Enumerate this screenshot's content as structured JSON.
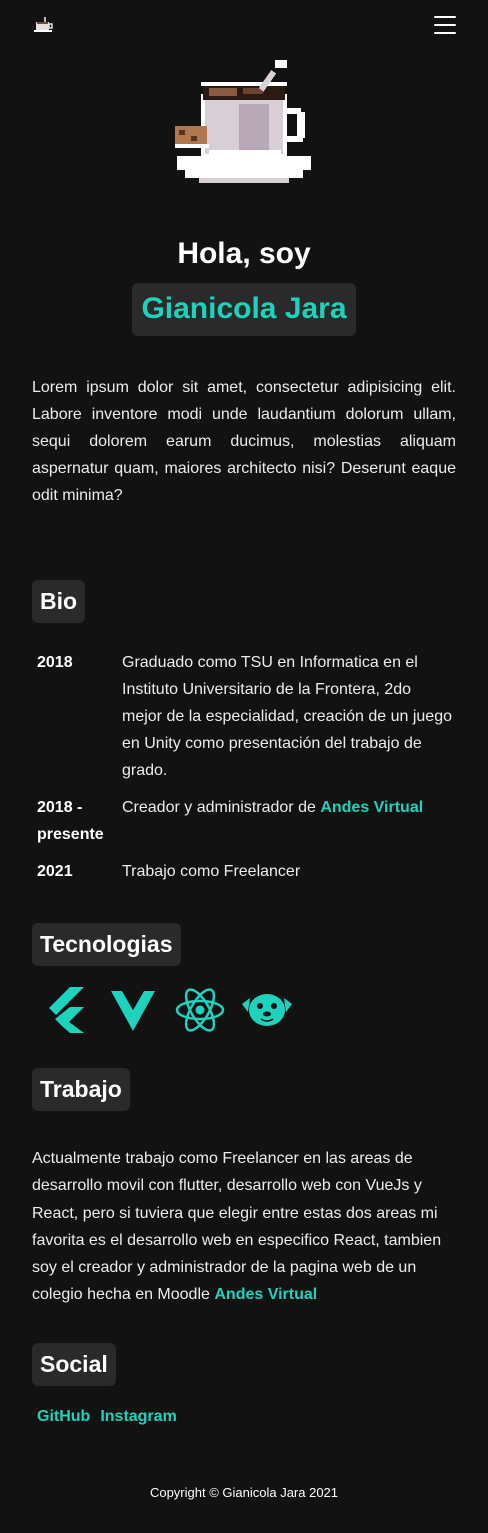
{
  "nav": {
    "logo_icon": "coffee-cup-icon",
    "menu_icon": "hamburger-menu-icon"
  },
  "hero": {
    "image_icon": "pixel-coffee-cup-icon",
    "greeting": "Hola, soy",
    "name": "Gianicola Jara",
    "intro": "Lorem ipsum dolor sit amet, consectetur adipisicing elit. Labore inventore modi unde laudantium dolorum ullam, sequi dolorem earum ducimus, molestias aliquam aspernatur quam, maiores architecto nisi? Deserunt eaque odit minima?"
  },
  "bio": {
    "heading": "Bio",
    "entries": [
      {
        "year": "2018",
        "text": "Graduado como TSU en Informatica en el Instituto Universitario de la Frontera, 2do mejor de la especialidad, creación de un juego en Unity como presentación del trabajo de grado."
      },
      {
        "year": "2018 - presente",
        "text": "Creador y administrador de ",
        "link": "Andes Virtual"
      },
      {
        "year": "2021",
        "text": "Trabajo como Freelancer"
      }
    ]
  },
  "tech": {
    "heading": "Tecnologias",
    "icons": [
      "flutter-icon",
      "vue-icon",
      "react-icon",
      "pug-icon"
    ]
  },
  "work": {
    "heading": "Trabajo",
    "text": "Actualmente trabajo como Freelancer en las areas de desarrollo movil con flutter, desarrollo web con VueJs y React, pero si tuviera que elegir entre estas dos areas mi favorita es el desarrollo web en especifico React, tambien soy el creador y administrador de la pagina web de un colegio hecha en Moodle ",
    "link": "Andes Virtual"
  },
  "social": {
    "heading": "Social",
    "links": [
      "GitHub",
      "Instagram"
    ]
  },
  "footer": {
    "text": "Copyright © Gianicola Jara 2021"
  },
  "colors": {
    "accent": "#1dd3bd",
    "background": "#121212",
    "pill": "#2a2a2a"
  }
}
